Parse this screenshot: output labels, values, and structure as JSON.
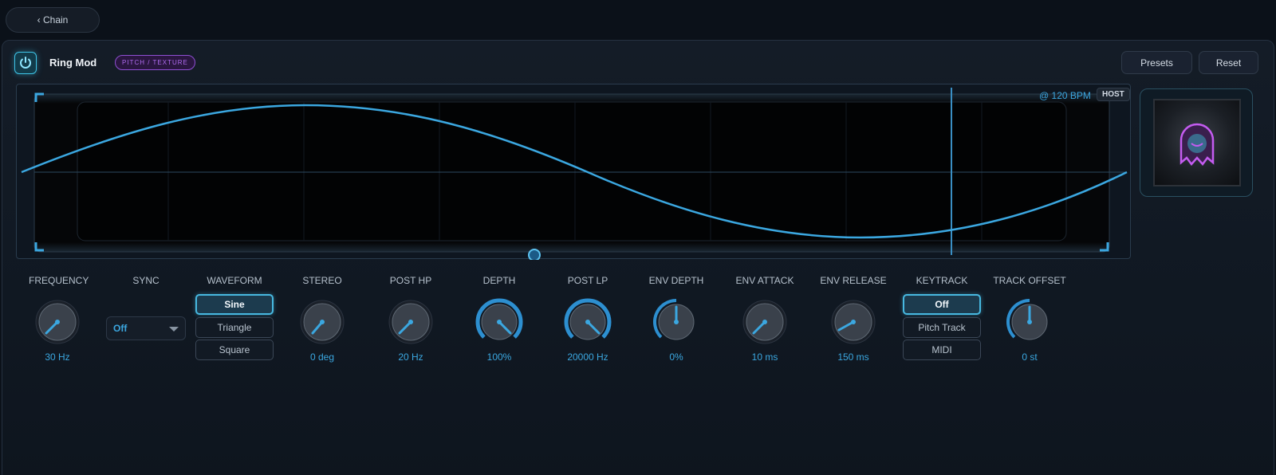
{
  "nav": {
    "back_label": "‹ Chain"
  },
  "module": {
    "title": "Ring Mod",
    "category": "PITCH / TEXTURE",
    "presets_label": "Presets",
    "reset_label": "Reset"
  },
  "scope": {
    "bpm_label": "@ 120 BPM",
    "host_label": "HOST",
    "waveform": "sine"
  },
  "controls": {
    "frequency": {
      "label": "FREQUENCY",
      "value": "30 Hz"
    },
    "sync": {
      "label": "SYNC",
      "value": "Off"
    },
    "waveform": {
      "label": "WAVEFORM",
      "options": [
        "Sine",
        "Triangle",
        "Square"
      ],
      "selected": "Sine"
    },
    "stereo": {
      "label": "STEREO",
      "value": "0 deg"
    },
    "post_hp": {
      "label": "POST HP",
      "value": "20 Hz"
    },
    "depth": {
      "label": "DEPTH",
      "value": "100%"
    },
    "post_lp": {
      "label": "POST LP",
      "value": "20000 Hz"
    },
    "env_depth": {
      "label": "ENV DEPTH",
      "value": "0%"
    },
    "env_attack": {
      "label": "ENV ATTACK",
      "value": "10 ms"
    },
    "env_release": {
      "label": "ENV RELEASE",
      "value": "150 ms"
    },
    "keytrack": {
      "label": "KEYTRACK",
      "options": [
        "Off",
        "Pitch Track",
        "MIDI"
      ],
      "selected": "Off"
    },
    "track_offset": {
      "label": "TRACK OFFSET",
      "value": "0 st"
    }
  },
  "colors": {
    "accent": "#3ba7e0",
    "badge": "#b06cf0",
    "panel": "#121a24"
  }
}
